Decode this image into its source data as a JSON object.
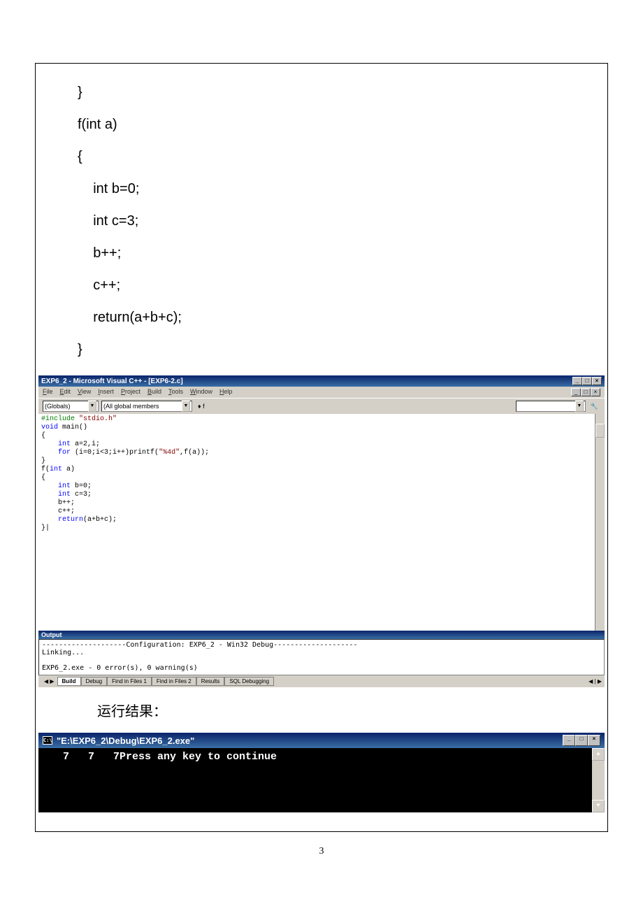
{
  "code_block": {
    "lines": [
      "}",
      "f(int a)",
      "{",
      "    int b=0;",
      "    int c=3;",
      "    b++;",
      "    c++;",
      "    return(a+b+c);",
      "}"
    ]
  },
  "ide": {
    "title": "EXP6_2 - Microsoft Visual C++ - [EXP6-2.c]",
    "menus": [
      "File",
      "Edit",
      "View",
      "Insert",
      "Project",
      "Build",
      "Tools",
      "Window",
      "Help"
    ],
    "scope": "(Globals)",
    "members": "(All global members",
    "func": "♦ f",
    "editor_raw": "#include \"stdio.h\"\nvoid main()\n{\n    int a=2,i;\n    for (i=0;i<3;i++)printf(\"%4d\",f(a));\n}\nf(int a)\n{\n    int b=0;\n    int c=3;\n    b++;\n    c++;\n    return(a+b+c);\n}|",
    "output_title": "Output",
    "output_raw": "--------------------Configuration: EXP6_2 - Win32 Debug--------------------\nLinking...\n\nEXP6_2.exe - 0 error(s), 0 warning(s)",
    "tabs": [
      "Build",
      "Debug",
      "Find in Files 1",
      "Find in Files 2",
      "Results",
      "SQL Debugging"
    ]
  },
  "chart_data": {
    "type": "table",
    "title": "Build output",
    "rows": [
      [
        "Configuration",
        "EXP6_2 - Win32 Debug"
      ],
      [
        "Linking",
        "..."
      ],
      [
        "EXP6_2.exe",
        "0 error(s), 0 warning(s)"
      ]
    ]
  },
  "result_label": "运行结果：",
  "console": {
    "title": "\"E:\\EXP6_2\\Debug\\EXP6_2.exe\"",
    "body": "   7   7   7Press any key to continue"
  },
  "page_number": "3"
}
